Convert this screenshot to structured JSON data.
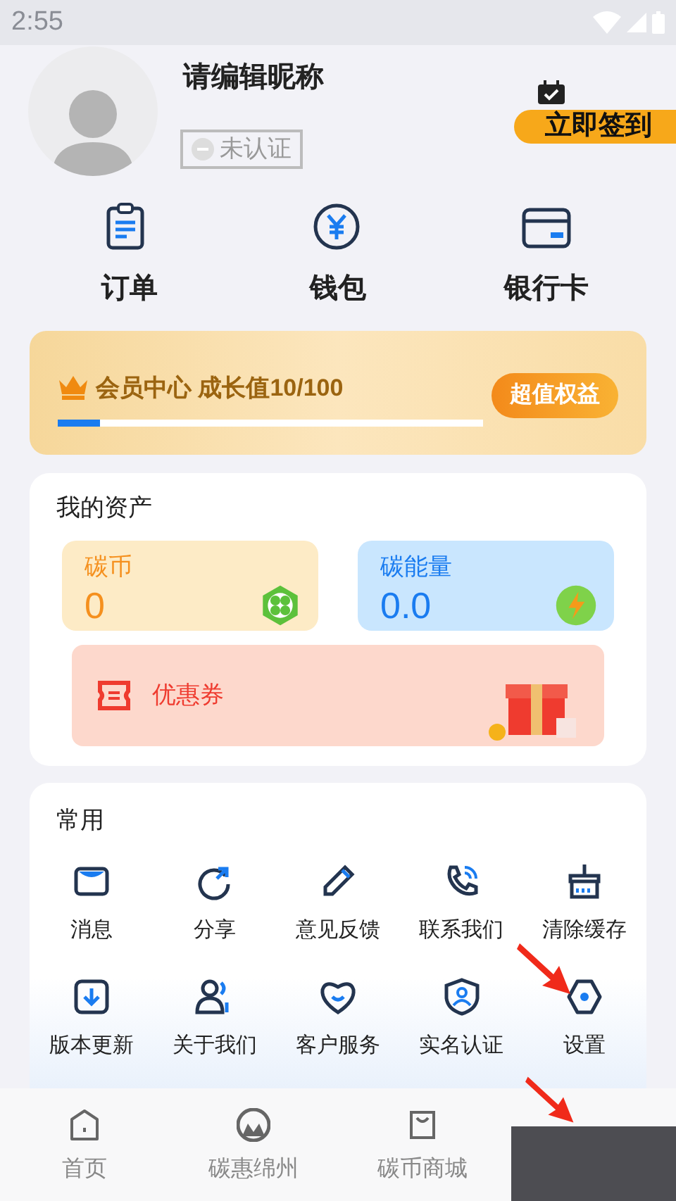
{
  "status_bar": {
    "time": "2:55"
  },
  "profile": {
    "nickname": "请编辑昵称",
    "verify_badge": "未认证",
    "sign_in_button": "立即签到"
  },
  "quick_links": [
    {
      "kind": "order",
      "label": "订单"
    },
    {
      "kind": "wallet",
      "label": "钱包"
    },
    {
      "kind": "card",
      "label": "银行卡"
    }
  ],
  "member": {
    "title": "会员中心 成长值10/100",
    "level": 0.1,
    "button": "超值权益"
  },
  "assets": {
    "title": "我的资产",
    "tiles": [
      {
        "kind": "coin",
        "label": "碳币",
        "value": "0"
      },
      {
        "kind": "energy",
        "label": "碳能量",
        "value": "0.0"
      }
    ],
    "coupon": "优惠券"
  },
  "common": {
    "title": "常用",
    "items": [
      {
        "kind": "mail",
        "label": "消息"
      },
      {
        "kind": "share",
        "label": "分享"
      },
      {
        "kind": "pen",
        "label": "意见反馈"
      },
      {
        "kind": "phone",
        "label": "联系我们"
      },
      {
        "kind": "broom",
        "label": "清除缓存"
      },
      {
        "kind": "download",
        "label": "版本更新"
      },
      {
        "kind": "users",
        "label": "关于我们"
      },
      {
        "kind": "heart",
        "label": "客户服务"
      },
      {
        "kind": "shield",
        "label": "实名认证"
      },
      {
        "kind": "settings",
        "label": "设置"
      }
    ]
  },
  "bottom_nav": [
    {
      "kind": "home",
      "label": "首页",
      "selected": false
    },
    {
      "kind": "m",
      "label": "碳惠绵州",
      "selected": false
    },
    {
      "kind": "bag",
      "label": "碳币商城",
      "selected": false
    }
  ]
}
